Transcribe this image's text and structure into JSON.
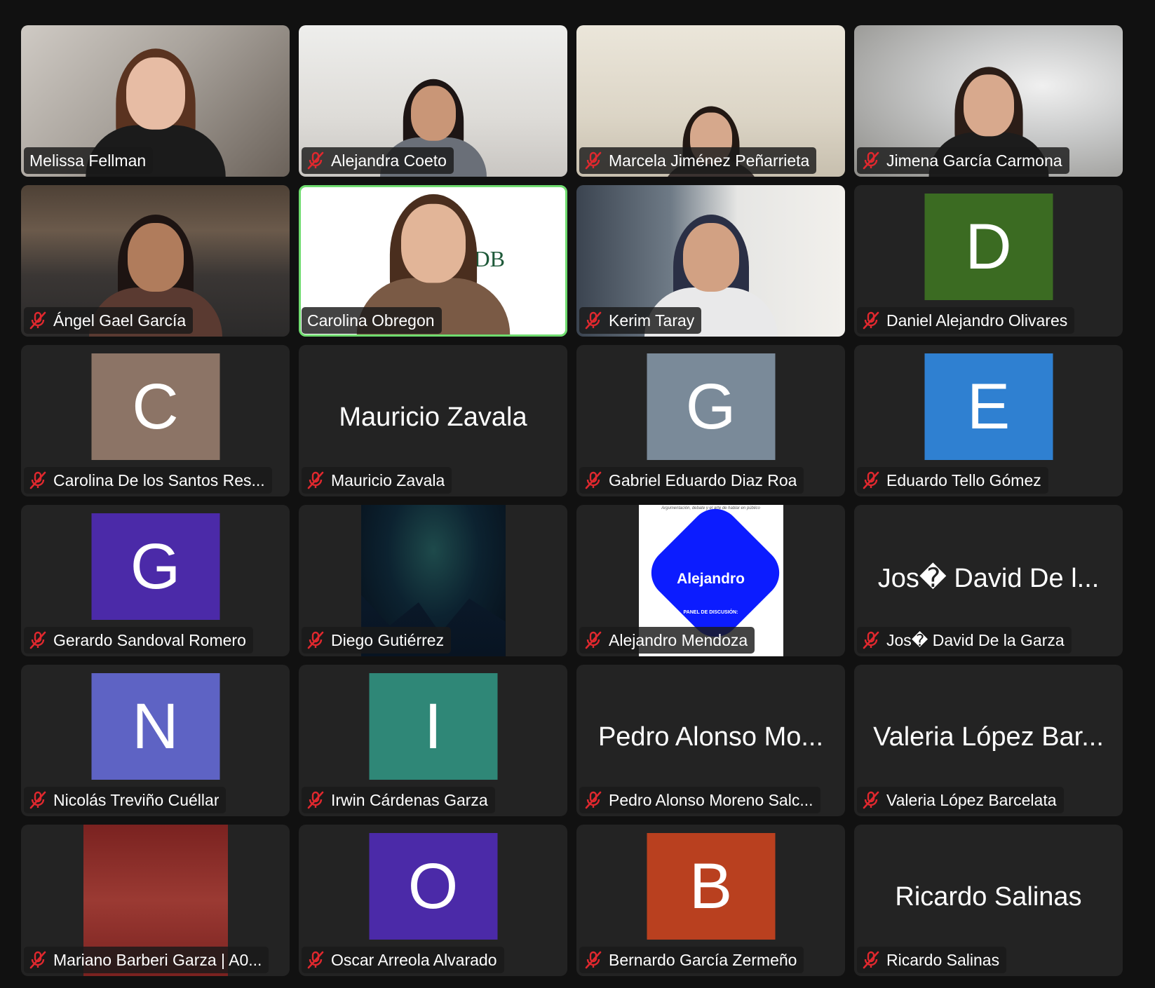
{
  "participants": [
    {
      "name": "Melissa Fellman",
      "muted": false,
      "type": "video",
      "background": "bg-room1"
    },
    {
      "name": "Alejandra Coeto",
      "muted": true,
      "type": "video",
      "background": "bg-wall"
    },
    {
      "name": "Marcela Jiménez Peñarrieta",
      "muted": true,
      "type": "video",
      "background": "bg-warm"
    },
    {
      "name": "Jimena García Carmona",
      "muted": true,
      "type": "video",
      "background": "bg-blur"
    },
    {
      "name": "Ángel Gael García",
      "muted": true,
      "type": "video",
      "background": "bg-office"
    },
    {
      "name": "Carolina Obregon",
      "muted": false,
      "type": "video",
      "background": "bg-logo",
      "speaking": true,
      "logo_text": "DB"
    },
    {
      "name": "Kerim Taray",
      "muted": true,
      "type": "video",
      "background": "bg-window"
    },
    {
      "name": "Daniel Alejandro Olivares",
      "muted": true,
      "type": "avatar",
      "initial": "D",
      "color": "#3b6b22"
    },
    {
      "name": "Carolina De los Santos Res...",
      "muted": true,
      "type": "avatar",
      "initial": "C",
      "color": "#8c7466"
    },
    {
      "name": "Mauricio Zavala",
      "muted": true,
      "type": "bigname",
      "big": "Mauricio Zavala"
    },
    {
      "name": "Gabriel Eduardo Diaz Roa",
      "muted": true,
      "type": "avatar",
      "initial": "G",
      "color": "#7a8a99"
    },
    {
      "name": "Eduardo Tello Gómez",
      "muted": true,
      "type": "avatar",
      "initial": "E",
      "color": "#2f80d1"
    },
    {
      "name": "Gerardo Sandoval Romero",
      "muted": true,
      "type": "avatar",
      "initial": "G",
      "color": "#4b2aa8"
    },
    {
      "name": "Diego Gutiérrez",
      "muted": true,
      "type": "image",
      "image": "night"
    },
    {
      "name": "Alejandro Mendoza",
      "muted": true,
      "type": "image",
      "image": "poster",
      "poster_title": "Alejandro",
      "poster_caption": "Argumentación, debate y el arte de hablar en público",
      "poster_sub": "PANEL DE DISCUSIÓN:"
    },
    {
      "name": "Jos� David De la Garza",
      "muted": true,
      "type": "bigname",
      "big": "Jos� David De l..."
    },
    {
      "name": "Nicolás Treviño Cuéllar",
      "muted": true,
      "type": "avatar",
      "initial": "N",
      "color": "#5e63c4"
    },
    {
      "name": "Irwin Cárdenas Garza",
      "muted": true,
      "type": "avatar",
      "initial": "I",
      "color": "#2f8777"
    },
    {
      "name": "Pedro Alonso Moreno Salc...",
      "muted": true,
      "type": "bigname",
      "big": "Pedro Alonso Mo..."
    },
    {
      "name": "Valeria López Barcelata",
      "muted": true,
      "type": "bigname",
      "big": "Valeria López Bar..."
    },
    {
      "name": "Mariano Barberi Garza | A0...",
      "muted": true,
      "type": "avatar",
      "initial": "",
      "color": "#8a2a28",
      "tall": true
    },
    {
      "name": "Oscar Arreola Alvarado",
      "muted": true,
      "type": "avatar",
      "initial": "O",
      "color": "#4b2aa8"
    },
    {
      "name": "Bernardo García Zermeño",
      "muted": true,
      "type": "avatar",
      "initial": "B",
      "color": "#b9401f"
    },
    {
      "name": "Ricardo Salinas",
      "muted": true,
      "type": "bigname",
      "big": "Ricardo Salinas"
    }
  ],
  "icons": {
    "mute": "microphone-muted-icon"
  },
  "colors": {
    "mute_icon": "#e0282e",
    "speaking_border": "#6fdc6f"
  }
}
